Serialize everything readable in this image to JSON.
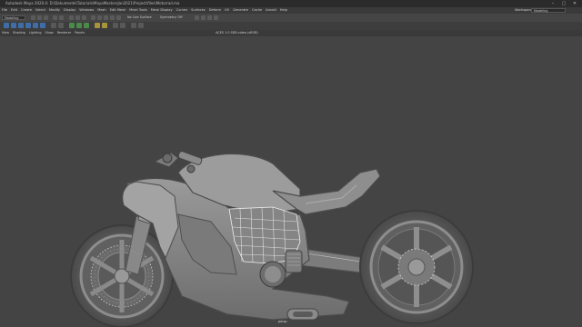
{
  "window": {
    "title": "Autodesk Maya 2020.4: D:\\Dokumente\\Tutorials\\MayaMastersJan2021\\Project\\files\\Motorrad.ma",
    "controls": [
      "–",
      "▢",
      "✕"
    ]
  },
  "menubar": {
    "items": [
      "File",
      "Edit",
      "Create",
      "Select",
      "Modify",
      "Display",
      "Windows",
      "Mesh",
      "Edit Mesh",
      "Mesh Tools",
      "Mesh Display",
      "Curves",
      "Surfaces",
      "Deform",
      "UV",
      "Generate",
      "Cache",
      "Arnold",
      "Help"
    ],
    "workspace_label": "Workspace:",
    "workspace_value": "Modeling"
  },
  "statusline": {
    "mode": "Modeling",
    "live_surface": "No Live Surface",
    "symmetry": "Symmetry: Off"
  },
  "shelf": {
    "tabs": [
      "Curves / Surfaces",
      "Poly Modeling",
      "Sculpting",
      "Rigging",
      "Animation",
      "Rendering",
      "FX",
      "FX Caching",
      "Custom",
      "Arnold",
      "Bifrost",
      "MASH",
      "Motion Graphics",
      "XGen"
    ]
  },
  "panel": {
    "menus": [
      "View",
      "Shading",
      "Lighting",
      "Show",
      "Renderer",
      "Panels"
    ],
    "color_space": "ACES 1.0 SDR-video (sRGB)",
    "camera": "persp"
  },
  "colors": {
    "viewport_bg": "#444444",
    "model_fill": "#8a8a8a",
    "model_dark": "#5f5f5f",
    "wire": "#d8d8d8"
  }
}
